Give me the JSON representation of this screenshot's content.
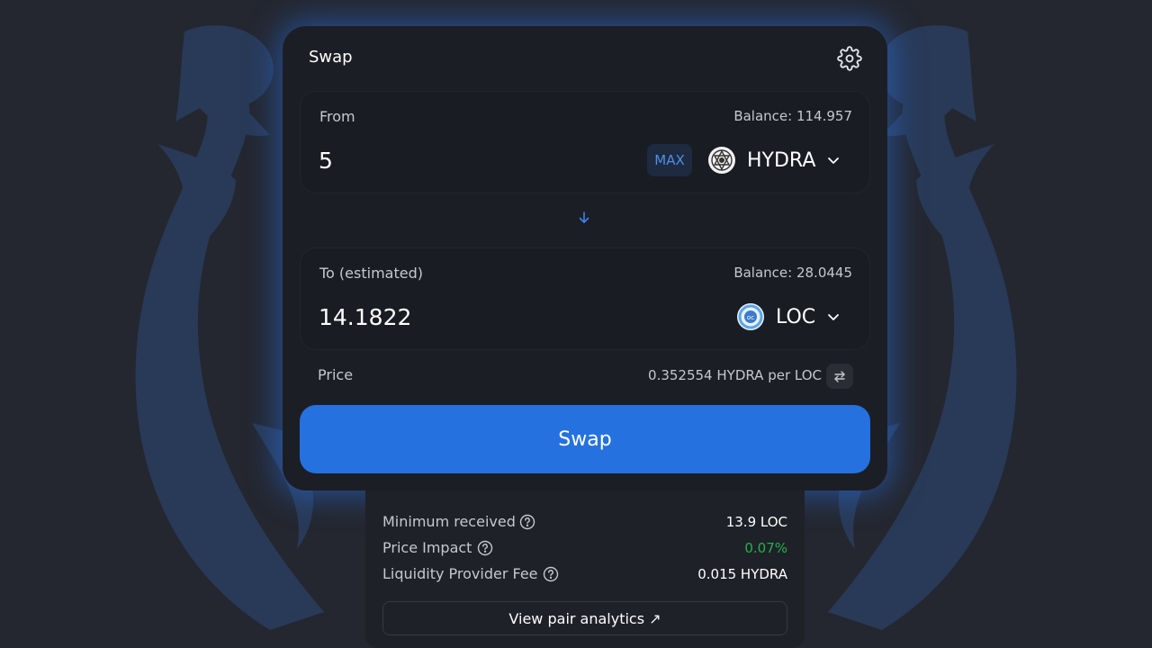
{
  "swap_card": {
    "title": "Swap",
    "settings_icon": "gear-icon"
  },
  "from": {
    "label": "From",
    "balance": "Balance: 114.957",
    "amount": "5",
    "max_label": "MAX",
    "token": "HYDRA"
  },
  "switch_icon": "arrow-down-icon",
  "to": {
    "label": "To (estimated)",
    "balance": "Balance: 28.0445",
    "amount": "14.1822",
    "token": "LOC"
  },
  "price": {
    "label": "Price",
    "value": "0.352554 HYDRA per LOC"
  },
  "swap_button": "Swap",
  "details": {
    "rows": [
      {
        "label": "Minimum received",
        "value": "13.9 LOC"
      },
      {
        "label": "Price Impact",
        "value": "0.07%"
      },
      {
        "label": "Liquidity Provider Fee",
        "value": "0.015 HYDRA"
      }
    ],
    "analytics_link": "View pair analytics ↗"
  },
  "colors": {
    "background": "#242730",
    "card": "#1c1e25",
    "accent": "#2571e0",
    "max_text": "#4f8fe6",
    "positive": "#22b24a",
    "glow": "#2a6edc"
  }
}
